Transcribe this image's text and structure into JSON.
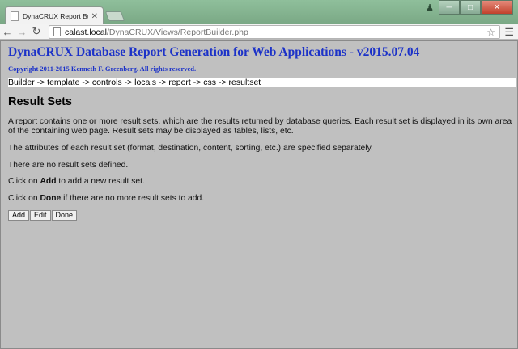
{
  "browser": {
    "tab_title": "DynaCRUX Report Builder",
    "url_host": "calast.local",
    "url_path": "/DynaCRUX/Views/ReportBuilder.php"
  },
  "page": {
    "app_title": "DynaCRUX Database Report Generation for Web Applications - v2015.07.04",
    "copyright": "Copyright 2011-2015 Kenneth F. Greenberg. All rights reserved.",
    "breadcrumb": "Builder -> template -> controls -> locals -> report -> css -> resultset",
    "section_title": "Result Sets",
    "intro": "A report contains one or more result sets, which are the results returned by database queries. Each result set is displayed in its own area of the containing web page. Result sets may be displayed as tables, lists, etc.",
    "attributes_note": "The attributes of each result set (format, destination, content, sorting, etc.) are specified separately.",
    "status": "There are no result sets defined.",
    "add_prefix": "Click on ",
    "add_word": "Add",
    "add_suffix": " to add a new result set.",
    "done_prefix": "Click on ",
    "done_word": "Done",
    "done_suffix": " if there are no more result sets to add.",
    "buttons": {
      "add": "Add",
      "edit": "Edit",
      "done": "Done"
    }
  }
}
